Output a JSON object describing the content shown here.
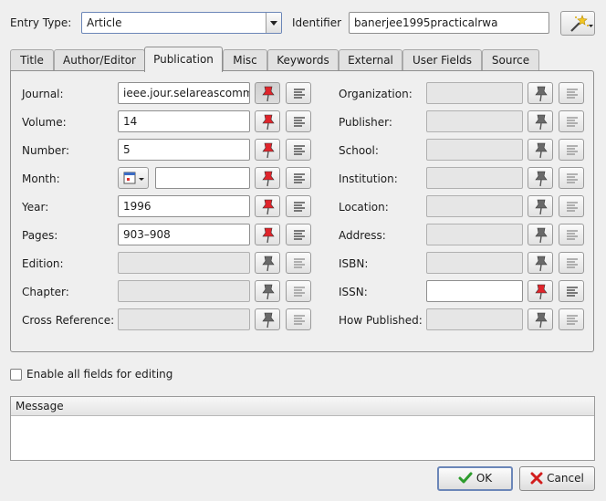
{
  "header": {
    "entry_type_label": "Entry Type:",
    "entry_type_value": "Article",
    "identifier_label": "Identifier",
    "identifier_value": "banerjee1995practicalrwa"
  },
  "tabs": [
    {
      "label": "Title"
    },
    {
      "label": "Author/Editor"
    },
    {
      "label": "Publication",
      "active": true
    },
    {
      "label": "Misc"
    },
    {
      "label": "Keywords"
    },
    {
      "label": "External"
    },
    {
      "label": "User Fields"
    },
    {
      "label": "Source"
    }
  ],
  "left_fields": [
    {
      "label": "Journal:",
      "value": "ieee.jour.selareascomm",
      "enabled": true
    },
    {
      "label": "Volume:",
      "value": "14",
      "enabled": true
    },
    {
      "label": "Number:",
      "value": "5",
      "enabled": true
    },
    {
      "label": "Month:",
      "value": "",
      "enabled": true
    },
    {
      "label": "Year:",
      "value": "1996",
      "enabled": true
    },
    {
      "label": "Pages:",
      "value": "903–908",
      "enabled": true
    },
    {
      "label": "Edition:",
      "value": "",
      "enabled": false
    },
    {
      "label": "Chapter:",
      "value": "",
      "enabled": false
    },
    {
      "label": "Cross Reference:",
      "value": "",
      "enabled": false
    }
  ],
  "right_fields": [
    {
      "label": "Organization:",
      "value": "",
      "enabled": false
    },
    {
      "label": "Publisher:",
      "value": "",
      "enabled": false
    },
    {
      "label": "School:",
      "value": "",
      "enabled": false
    },
    {
      "label": "Institution:",
      "value": "",
      "enabled": false
    },
    {
      "label": "Location:",
      "value": "",
      "enabled": false
    },
    {
      "label": "Address:",
      "value": "",
      "enabled": false
    },
    {
      "label": "ISBN:",
      "value": "",
      "enabled": false
    },
    {
      "label": "ISSN:",
      "value": "",
      "enabled": true
    },
    {
      "label": "How Published:",
      "value": "",
      "enabled": false
    }
  ],
  "enable_all_label": "Enable all fields for editing",
  "enable_all_checked": false,
  "message_header": "Message",
  "message_text": "",
  "buttons": {
    "ok": "OK",
    "cancel": "Cancel"
  },
  "colors": {
    "pin_red": "#e0242b",
    "pin_gray": "#6a6a6a",
    "ok_check": "#2d9c2d",
    "cancel_x": "#d21d1d",
    "default_border": "#6b86b8"
  },
  "icons": {
    "pin": "pushpin-icon",
    "source_text": "text-lines-icon",
    "calendar": "calendar-icon",
    "wand": "magic-wand-icon"
  }
}
